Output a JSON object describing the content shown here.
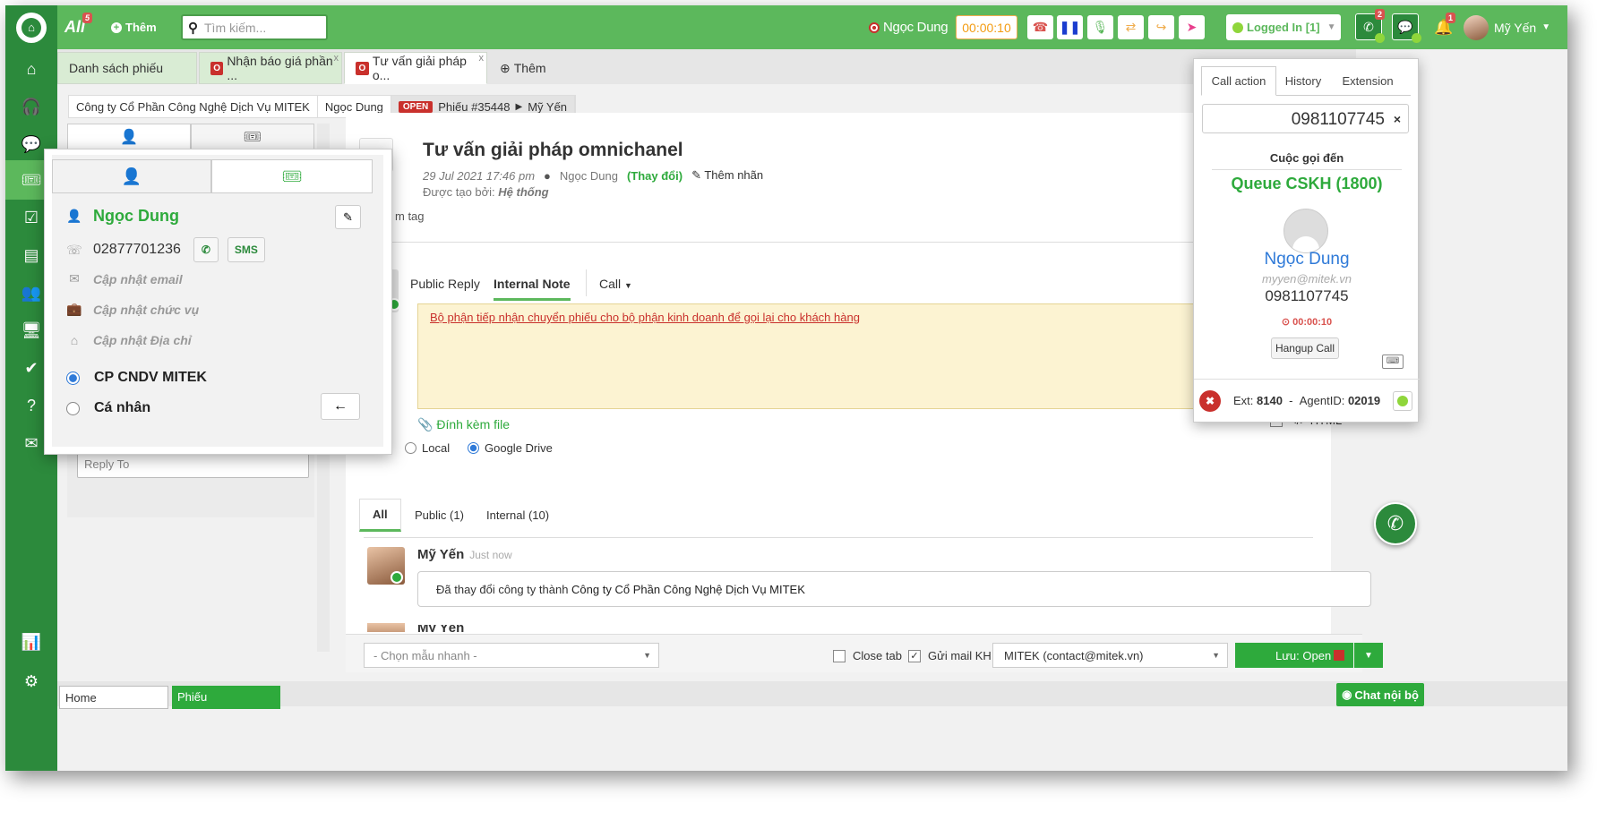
{
  "topbar": {
    "all_label": "All",
    "all_badge": "5",
    "add_label": "Thêm",
    "search_placeholder": "Tìm kiếm...",
    "caller_name": "Ngọc Dung",
    "call_timer": "00:00:10",
    "logged_in": "Logged In [1]",
    "call_badge": "2",
    "notif_badge": "1",
    "user_name": "Mỹ Yến"
  },
  "tabs": [
    {
      "label": "Danh sách phiếu"
    },
    {
      "label": "Nhận báo giá phần ...",
      "badge": "O"
    },
    {
      "label": "Tư vấn giải pháp o...",
      "badge": "O"
    },
    {
      "label": "Thêm"
    }
  ],
  "breadcrumb": {
    "company": "Công ty Cổ Phần Công Nghệ Dịch Vụ MITEK",
    "contact": "Ngọc Dung",
    "status": "OPEN",
    "ticket": "Phiếu #35448",
    "assignee": "Mỹ Yến"
  },
  "ticket": {
    "title": "Tư vấn giải pháp omnichanel",
    "date": "29 Jul 2021 17:46 pm",
    "contact": "Ngọc Dung",
    "change": "(Thay đổi)",
    "add_label": "Thêm nhãn",
    "created_by_label": "Được tạo bởi:",
    "created_by": "Hệ thống",
    "tag_fragment": "m tag"
  },
  "reply": {
    "tabs": [
      "Public Reply",
      "Internal Note",
      "Call"
    ],
    "note_text": "Bộ phận tiếp nhận chuyển phiếu cho bộ phận kinh doanh để gọi lại cho khách hàng",
    "attach_label": "Đính kèm file",
    "storage_options": [
      "Local",
      "Google Drive"
    ],
    "html_label": "HTML"
  },
  "history": {
    "tabs": [
      "All",
      "Public (1)",
      "Internal (10)"
    ],
    "entry_author": "Mỹ Yến",
    "entry_time": "Just now",
    "entry_text_prefix": "Đã thay đổi công ty thành ",
    "entry_text_company": "Công ty Cổ Phần Công Nghệ Dịch Vụ MITEK",
    "next_author_fragment": "Mỹ Yến"
  },
  "footer": {
    "quick_template": "- Chọn mẫu nhanh -",
    "close_tab": "Close tab",
    "send_mail": "Gửi mail KH",
    "mail_from": "MITEK (contact@mitek.vn)",
    "save_label": "Lưu: Open"
  },
  "reply_to": {
    "label": "Reply To",
    "placeholder": "Reply To"
  },
  "bottombar": {
    "home": "Home",
    "phieu": "Phiếu",
    "chat": "Chat nội bộ"
  },
  "contact_popup": {
    "name": "Ngọc Dung",
    "phone": "02877701236",
    "sms": "SMS",
    "email_placeholder": "Cập nhật email",
    "title_placeholder": "Cập nhật chức vụ",
    "address_placeholder": "Cập nhật Địa chỉ",
    "org_option": "CP CNDV MITEK",
    "personal_option": "Cá nhân"
  },
  "call_panel": {
    "tabs": [
      "Call action",
      "History",
      "Extension"
    ],
    "number": "0981107745",
    "incoming_label": "Cuộc gọi đến",
    "queue": "Queue CSKH (1800)",
    "caller_name": "Ngọc Dung",
    "caller_email": "myyen@mitek.vn",
    "caller_number": "0981107745",
    "timer": "00:00:10",
    "hangup": "Hangup Call",
    "ext_label": "Ext:",
    "ext": "8140",
    "agent_label": "AgentID:",
    "agent_id": "02019"
  }
}
